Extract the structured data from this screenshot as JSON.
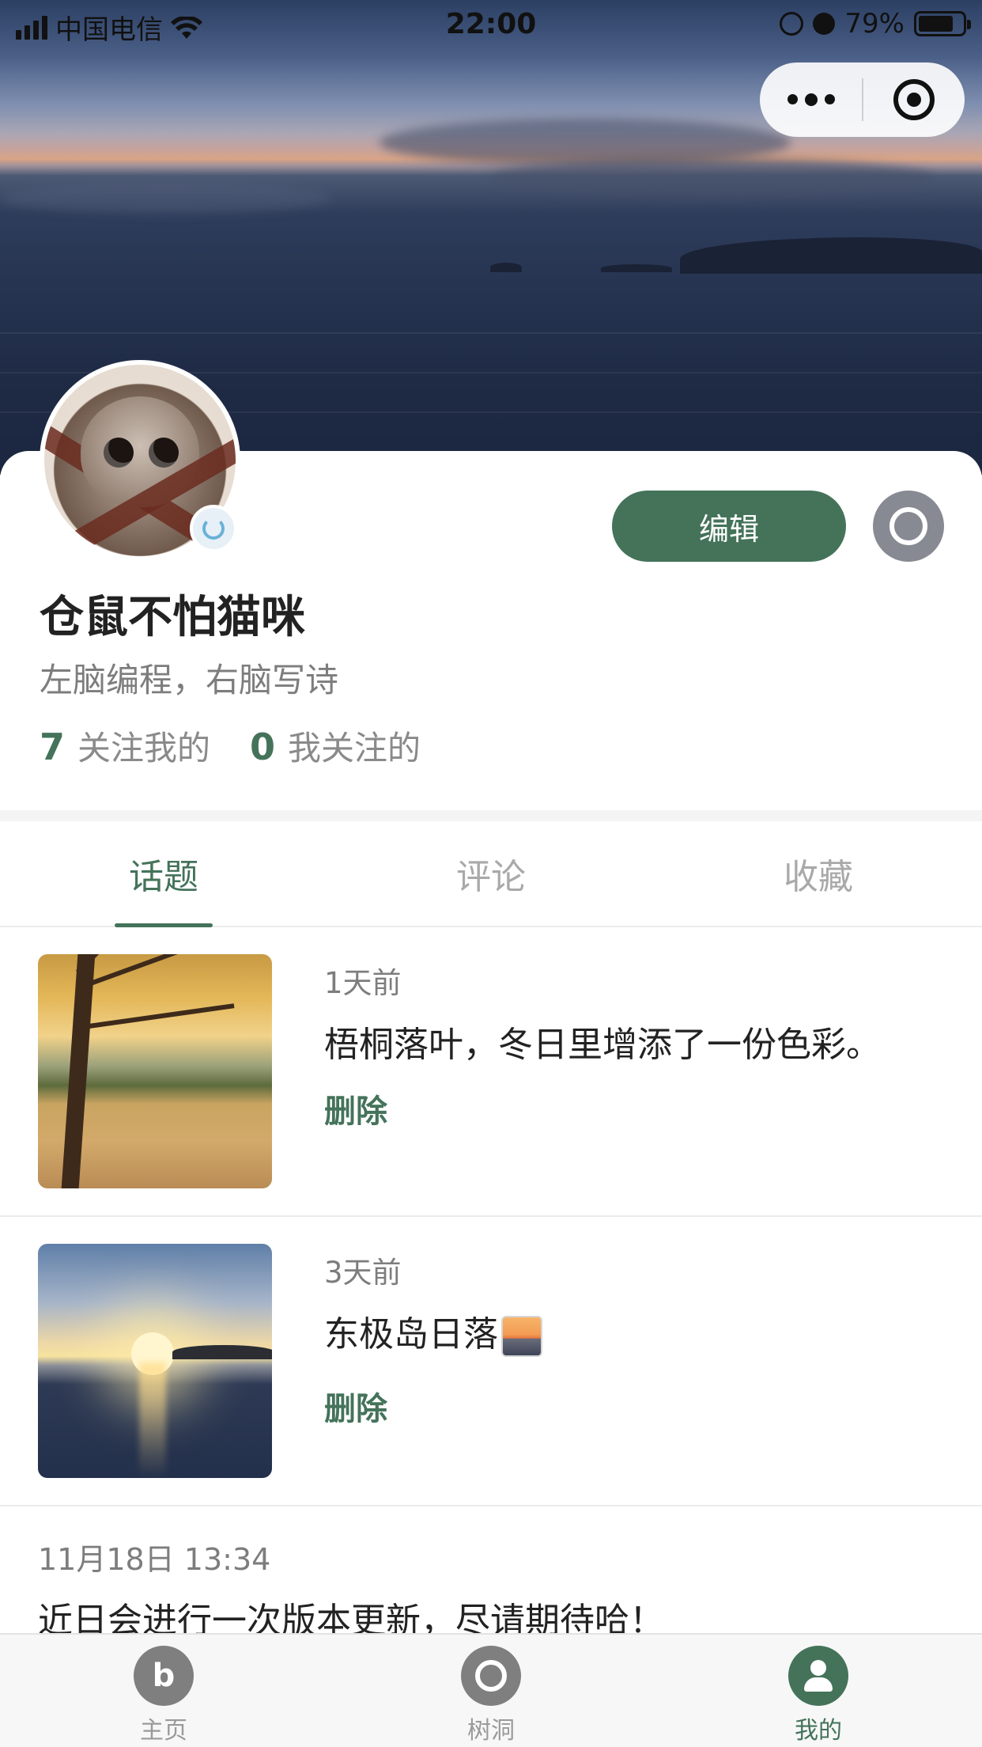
{
  "status_bar": {
    "carrier": "中国电信",
    "time": "22:00",
    "battery": "79%"
  },
  "capsule": {
    "more_icon": "more-dots-icon",
    "close_icon": "target-close-icon"
  },
  "profile": {
    "nickname": "仓鼠不怕猫咪",
    "bio": "左脑编程，右脑写诗",
    "followers_count": "7",
    "followers_label": "关注我的",
    "following_count": "0",
    "following_label": "我关注的",
    "edit_label": "编辑"
  },
  "tabs": [
    {
      "label": "话题",
      "active": true
    },
    {
      "label": "评论",
      "active": false
    },
    {
      "label": "收藏",
      "active": false
    }
  ],
  "posts": [
    {
      "time": "1天前",
      "text": "梧桐落叶，冬日里增添了一份色彩。",
      "action": "删除"
    },
    {
      "time": "3天前",
      "text": "东极岛日落",
      "action": "删除"
    }
  ],
  "notice": {
    "time": "11月18日 13:34",
    "text": "近日会进行一次版本更新，尽请期待哈！"
  },
  "tabbar": [
    {
      "label": "主页",
      "icon": "home-icon",
      "active": false
    },
    {
      "label": "树洞",
      "icon": "tree-hole-icon",
      "active": false
    },
    {
      "label": "我的",
      "icon": "profile-icon",
      "active": true
    }
  ],
  "colors": {
    "accent": "#44735a",
    "muted": "#7d7d7d",
    "settings_button": "#878a92"
  }
}
